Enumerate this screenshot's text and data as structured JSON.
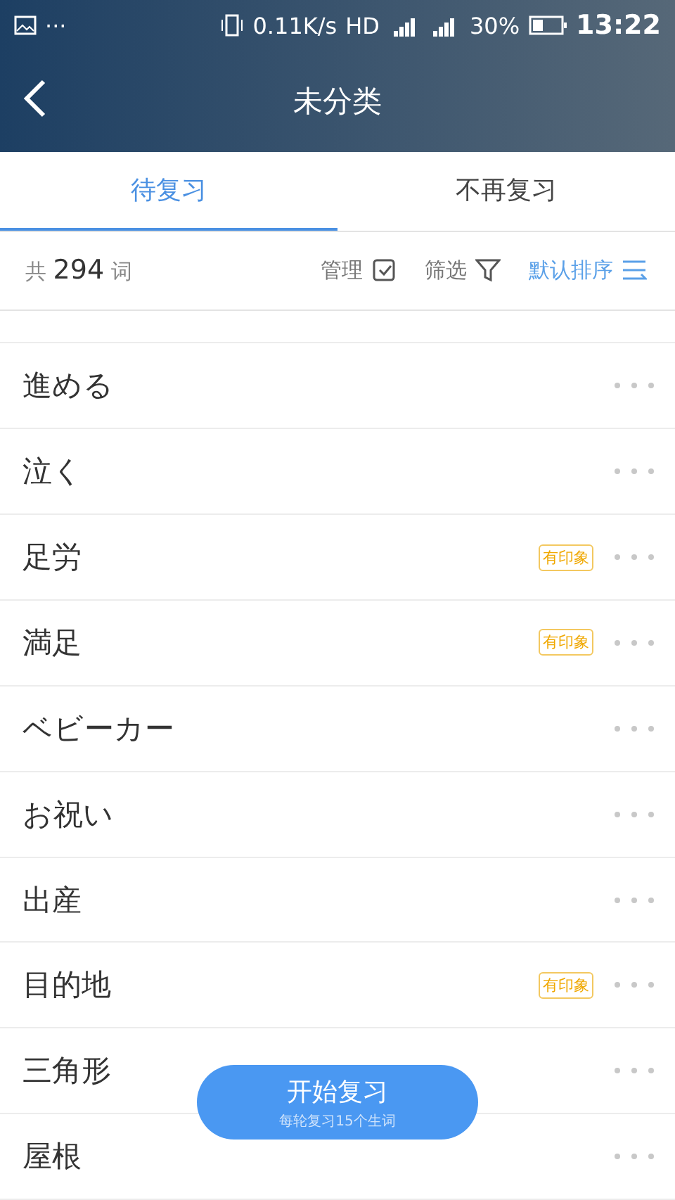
{
  "status_bar": {
    "menu": "···",
    "speed": "0.11K/s",
    "hd": "HD",
    "battery": "30%",
    "time": "13:22"
  },
  "header": {
    "title": "未分类"
  },
  "tabs": [
    {
      "label": "待复习",
      "selected": true
    },
    {
      "label": "不再复习",
      "selected": false
    }
  ],
  "toolbar": {
    "count_prefix": "共",
    "count": "294",
    "count_suffix": "词",
    "manage": "管理",
    "filter": "筛选",
    "sort": "默认排序"
  },
  "words": [
    {
      "word": "進める"
    },
    {
      "word": "泣く"
    },
    {
      "word": "足労",
      "badge": "有印象"
    },
    {
      "word": "満足",
      "badge": "有印象"
    },
    {
      "word": "ベビーカー"
    },
    {
      "word": "お祝い"
    },
    {
      "word": "出産"
    },
    {
      "word": "目的地",
      "badge": "有印象"
    },
    {
      "word": "三角形"
    },
    {
      "word": "屋根"
    }
  ],
  "start_button": {
    "label": "开始复习",
    "hint": "每轮复习15个生词"
  }
}
